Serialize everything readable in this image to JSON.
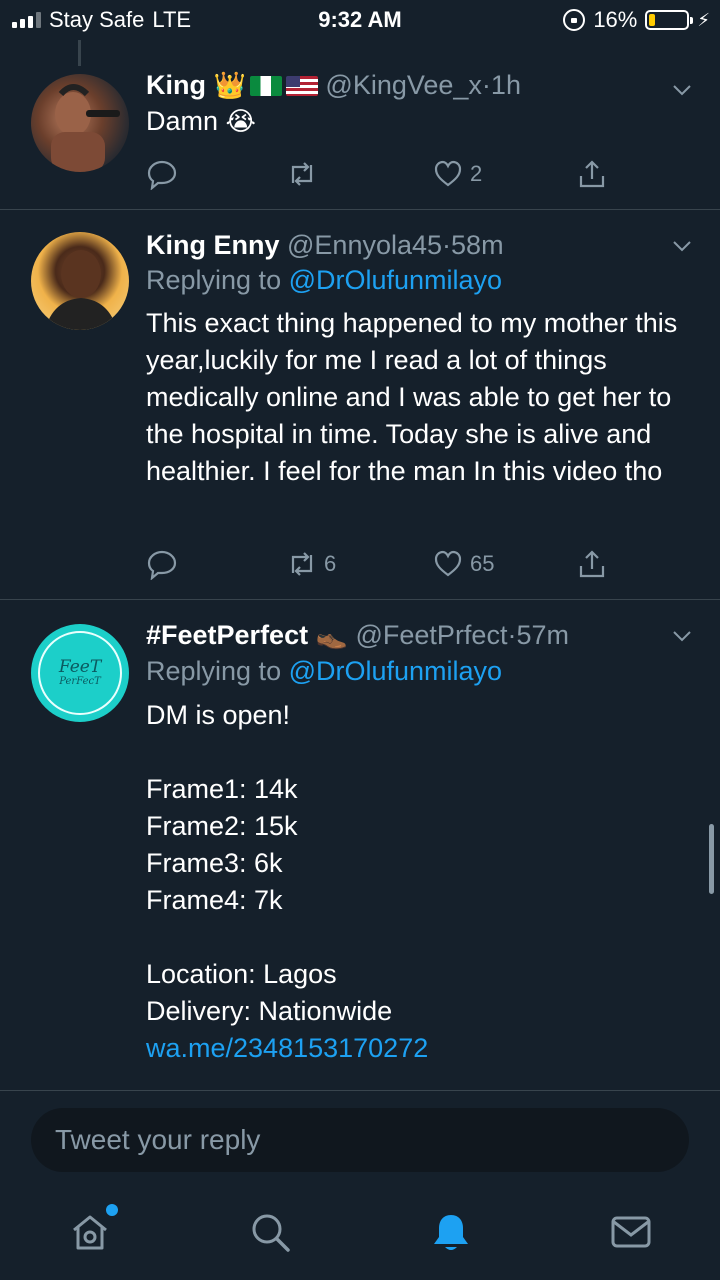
{
  "status_bar": {
    "carrier": "Stay Safe",
    "network": "LTE",
    "time": "9:32 AM",
    "battery_percent": "16%",
    "battery_level": 0.16,
    "battery_color": "#ffcc00"
  },
  "tweets": [
    {
      "name": "King",
      "name_emoji": "👑",
      "handle": "@KingVee_x",
      "separator": "·",
      "time": "1h",
      "text": "Damn",
      "text_emoji": "😭",
      "actions": {
        "reply_count": "",
        "retweet_count": "",
        "like_count": "2"
      }
    },
    {
      "name": "King Enny",
      "handle": "@Ennyola45",
      "separator": "·",
      "time": "58m",
      "replying_label": "Replying to",
      "replying_to": "@DrOlufunmilayo",
      "text": "This exact thing happened to my mother this year,luckily for me I read a lot of things medically online and I was able to get her to the hospital in time. Today she is alive and healthier. I feel for the man In this video tho",
      "actions": {
        "reply_count": "",
        "retweet_count": "6",
        "like_count": "65"
      }
    },
    {
      "name": "#FeetPerfect",
      "name_emoji": "👞",
      "handle": "@FeetPrfect",
      "separator": "·",
      "time": "57m",
      "replying_label": "Replying to",
      "replying_to": "@DrOlufunmilayo",
      "avatar_logo_line1": "FeeT",
      "avatar_logo_line2": "PerFecT",
      "text": "DM is open!\n\nFrame1: 14k\nFrame2: 15k\nFrame3: 6k\nFrame4: 7k\n\nLocation: Lagos\nDelivery: Nationwide",
      "link": "wa.me/2348153170272"
    }
  ],
  "reply_bar": {
    "placeholder": "Tweet your reply"
  },
  "tab_bar": {
    "items": [
      "home-icon",
      "search-icon",
      "notifications-icon",
      "messages-icon"
    ],
    "active": "notifications-icon",
    "accent_color": "#1da1f2"
  }
}
